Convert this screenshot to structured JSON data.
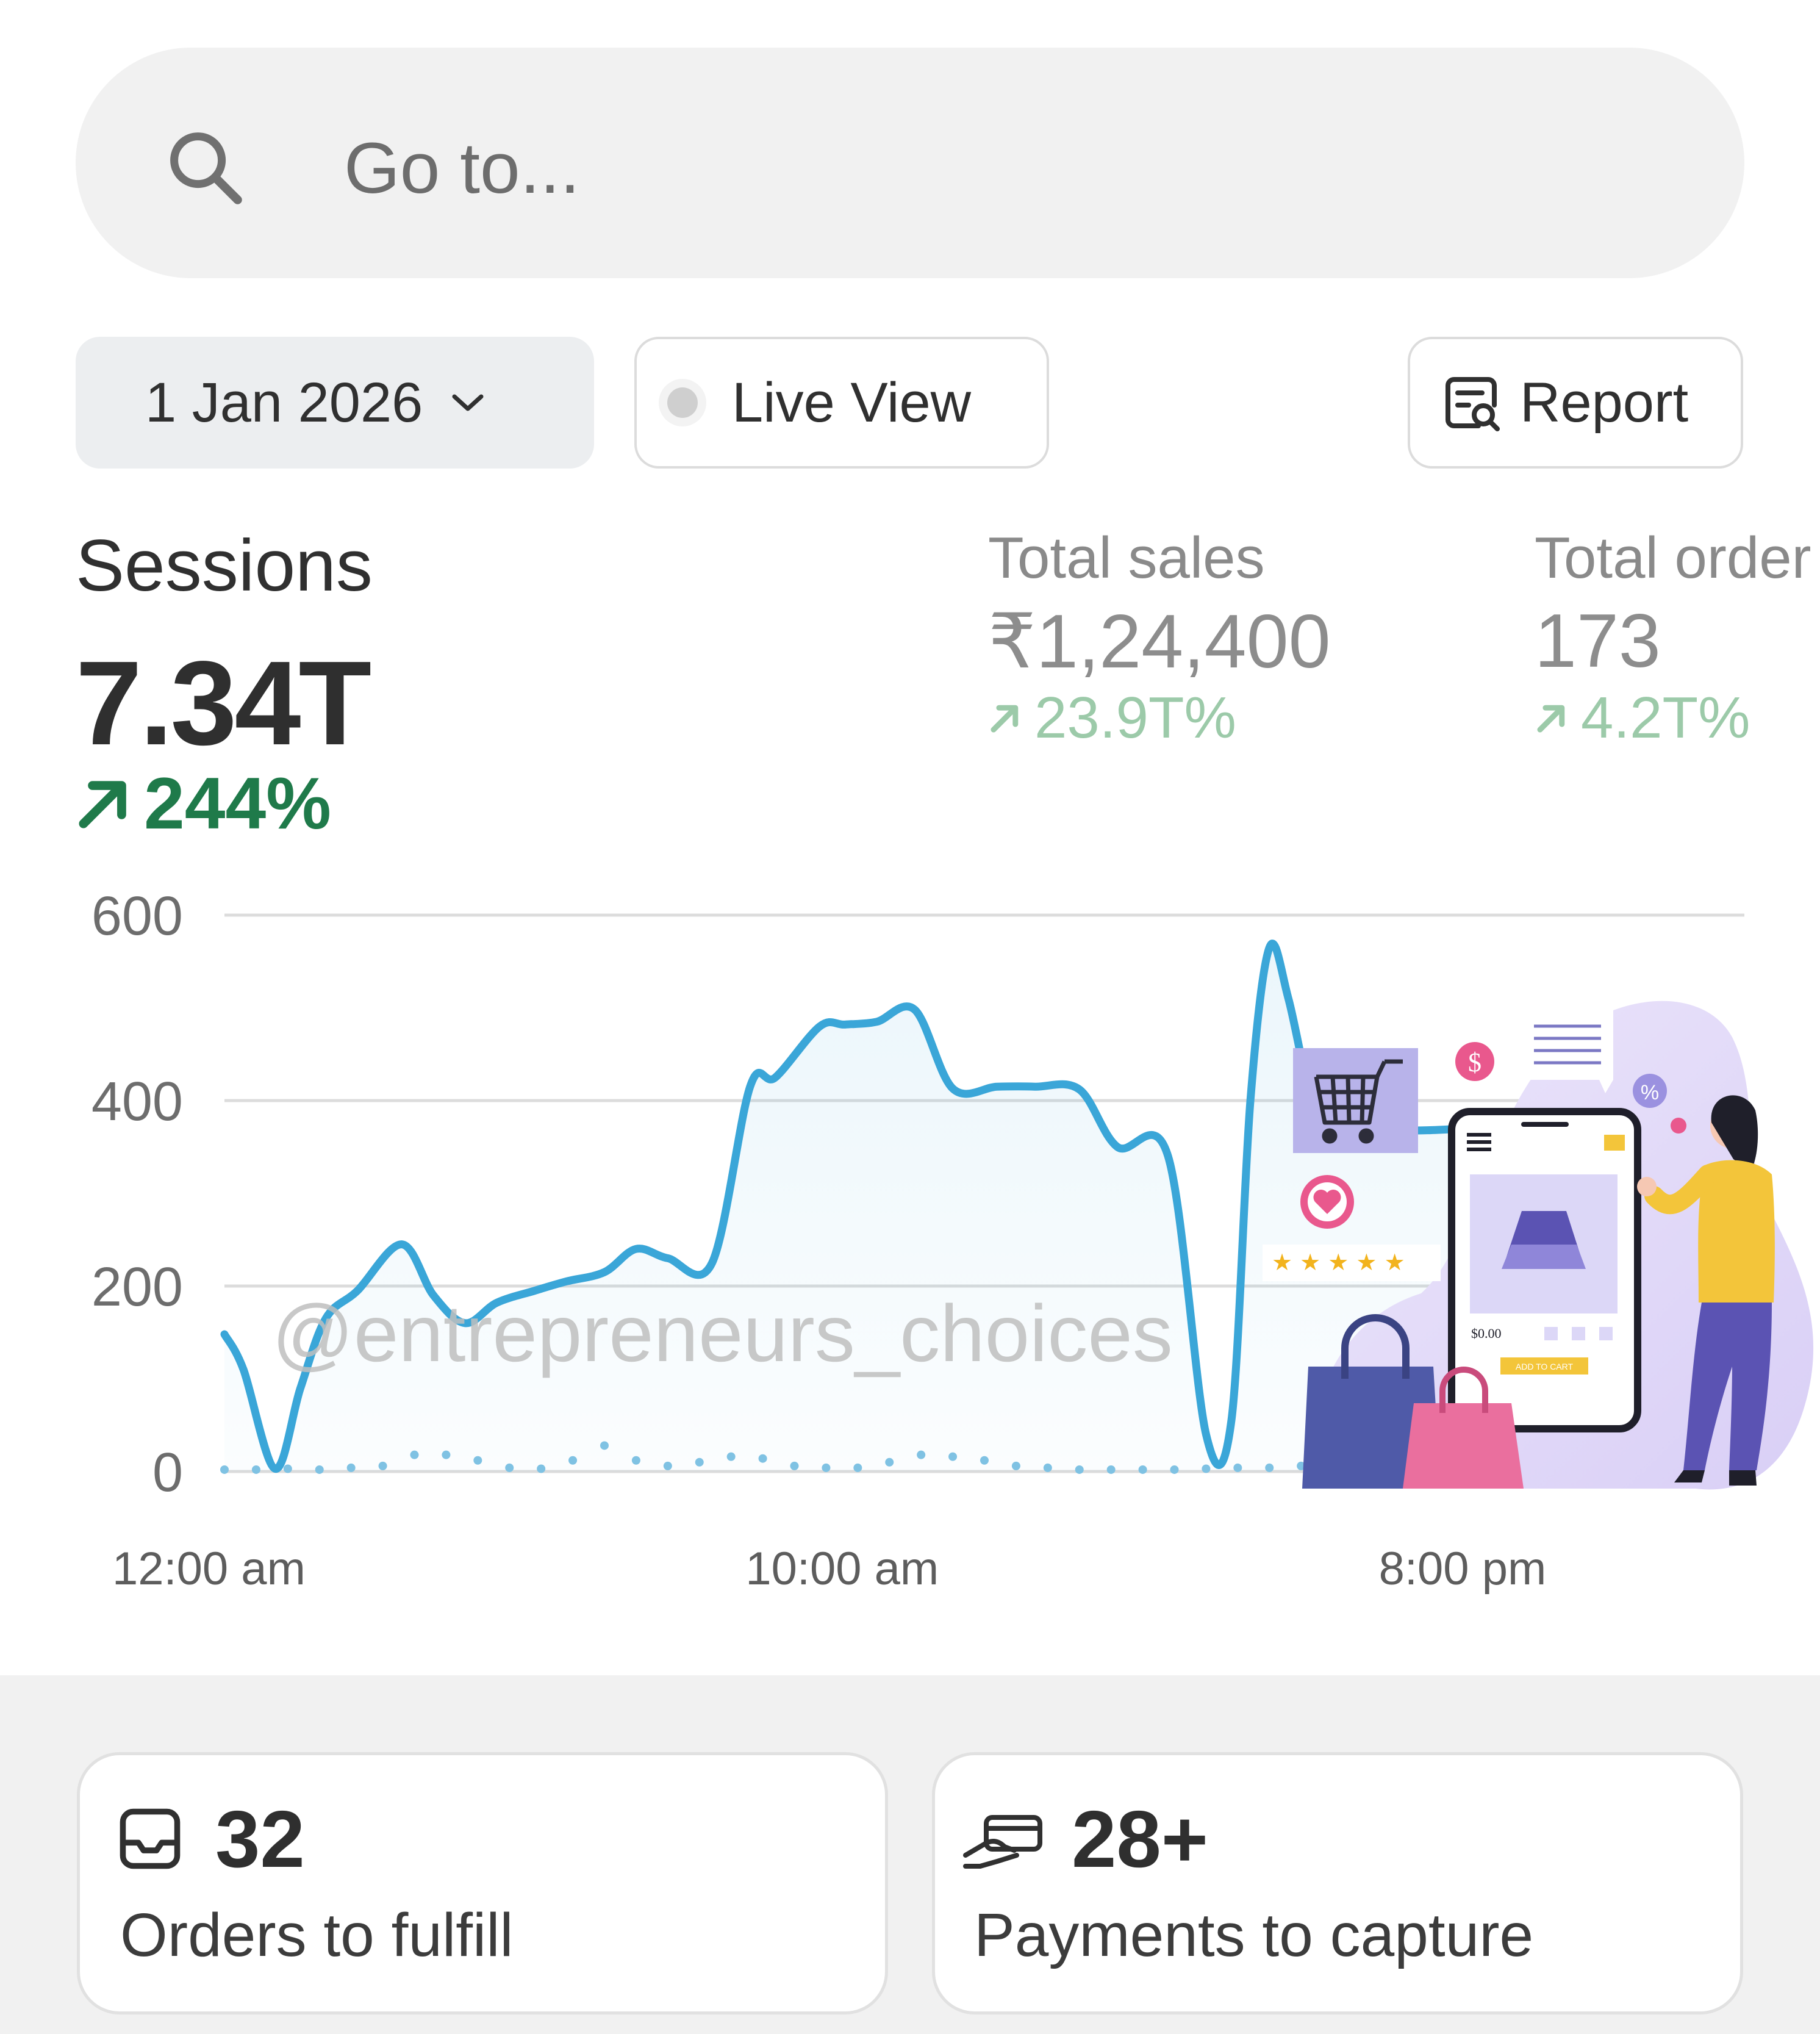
{
  "search": {
    "placeholder": "Go to..."
  },
  "toolbar": {
    "date_label": "1 Jan 2026",
    "live_view_label": "Live View",
    "report_label": "Report"
  },
  "metrics": {
    "sessions": {
      "label": "Sessions",
      "value": "7.34T",
      "change": "244%"
    },
    "total_sales": {
      "label": "Total sales",
      "value": "₹1,24,400",
      "change": "23.9T%"
    },
    "total_orders": {
      "label": "Total order",
      "value": "173",
      "change": "4.2T%"
    }
  },
  "watermark": "@entrepreneurs_choices",
  "tasks": [
    {
      "count": "32",
      "label": "Orders to fulfill",
      "icon": "inbox-icon"
    },
    {
      "count": "28+",
      "label": "Payments to capture",
      "icon": "hand-card-icon"
    }
  ],
  "colors": {
    "line": "#3aa6d8",
    "positive": "#1f7a4a",
    "positive_muted": "#9ccaa9",
    "grid": "#dcdcdc"
  },
  "chart_data": {
    "type": "line",
    "ylim": [
      0,
      600
    ],
    "yticks": [
      "0",
      "200",
      "400",
      "600"
    ],
    "xticks": [
      {
        "label": "12:00 am",
        "hour": 0
      },
      {
        "label": "10:00 am",
        "hour": 10
      },
      {
        "label": "8:00 pm",
        "hour": 20
      }
    ],
    "x_range": [
      0,
      24
    ],
    "grid": true,
    "series": [
      {
        "style": "solid",
        "x": [
          0,
          0.3,
          0.8,
          1.2,
          1.6,
          2.1,
          2.8,
          3.3,
          3.8,
          4.3,
          4.9,
          5.4,
          6.0,
          6.5,
          7.0,
          7.7,
          8.3,
          8.7,
          9.4,
          9.8,
          10.3,
          10.9,
          11.5,
          12.2,
          12.8,
          13.5,
          14.1,
          14.9,
          15.5,
          15.9,
          16.2,
          16.5,
          16.8,
          17.2,
          17.5,
          18.0,
          18.4,
          19.0,
          19.6,
          20.2
        ],
        "y": [
          148,
          110,
          3,
          90,
          165,
          195,
          245,
          190,
          160,
          182,
          195,
          205,
          215,
          240,
          230,
          225,
          415,
          425,
          480,
          482,
          485,
          498,
          413,
          415,
          415,
          412,
          350,
          340,
          40,
          55,
          400,
          565,
          510,
          390,
          380,
          372,
          368,
          368,
          370,
          372
        ]
      },
      {
        "style": "dotted",
        "x": [
          0,
          0.5,
          1,
          1.5,
          2,
          2.5,
          3,
          3.5,
          4,
          4.5,
          5,
          5.5,
          6,
          6.5,
          7,
          7.5,
          8,
          8.5,
          9,
          9.5,
          10,
          10.5,
          11,
          11.5,
          12,
          12.5,
          13,
          13.5,
          14,
          14.5,
          15,
          15.5,
          16,
          16.5,
          17,
          17.5,
          18,
          18.5,
          19,
          19.5,
          20
        ],
        "y": [
          2,
          2,
          3,
          2,
          4,
          6,
          18,
          18,
          12,
          4,
          3,
          12,
          28,
          12,
          6,
          10,
          16,
          14,
          6,
          4,
          4,
          10,
          18,
          16,
          12,
          6,
          4,
          2,
          2,
          2,
          2,
          3,
          4,
          4,
          6,
          8,
          6,
          4,
          2,
          2,
          2
        ]
      }
    ]
  }
}
